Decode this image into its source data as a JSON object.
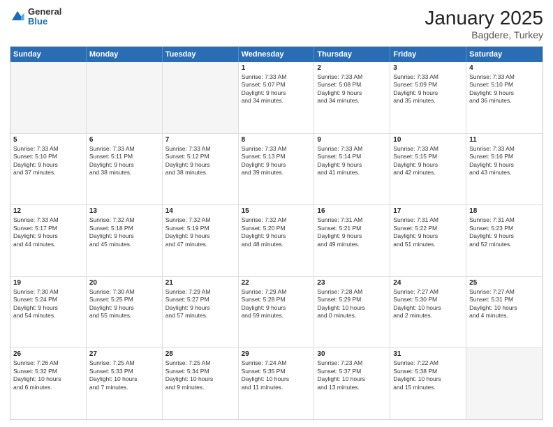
{
  "header": {
    "logo_general": "General",
    "logo_blue": "Blue",
    "title": "January 2025",
    "subtitle": "Bagdere, Turkey"
  },
  "calendar": {
    "days_of_week": [
      "Sunday",
      "Monday",
      "Tuesday",
      "Wednesday",
      "Thursday",
      "Friday",
      "Saturday"
    ],
    "weeks": [
      [
        {
          "day": "",
          "content": ""
        },
        {
          "day": "",
          "content": ""
        },
        {
          "day": "",
          "content": ""
        },
        {
          "day": "1",
          "content": "Sunrise: 7:33 AM\nSunset: 5:07 PM\nDaylight: 9 hours\nand 34 minutes."
        },
        {
          "day": "2",
          "content": "Sunrise: 7:33 AM\nSunset: 5:08 PM\nDaylight: 9 hours\nand 34 minutes."
        },
        {
          "day": "3",
          "content": "Sunrise: 7:33 AM\nSunset: 5:09 PM\nDaylight: 9 hours\nand 35 minutes."
        },
        {
          "day": "4",
          "content": "Sunrise: 7:33 AM\nSunset: 5:10 PM\nDaylight: 9 hours\nand 36 minutes."
        }
      ],
      [
        {
          "day": "5",
          "content": "Sunrise: 7:33 AM\nSunset: 5:10 PM\nDaylight: 9 hours\nand 37 minutes."
        },
        {
          "day": "6",
          "content": "Sunrise: 7:33 AM\nSunset: 5:11 PM\nDaylight: 9 hours\nand 38 minutes."
        },
        {
          "day": "7",
          "content": "Sunrise: 7:33 AM\nSunset: 5:12 PM\nDaylight: 9 hours\nand 38 minutes."
        },
        {
          "day": "8",
          "content": "Sunrise: 7:33 AM\nSunset: 5:13 PM\nDaylight: 9 hours\nand 39 minutes."
        },
        {
          "day": "9",
          "content": "Sunrise: 7:33 AM\nSunset: 5:14 PM\nDaylight: 9 hours\nand 41 minutes."
        },
        {
          "day": "10",
          "content": "Sunrise: 7:33 AM\nSunset: 5:15 PM\nDaylight: 9 hours\nand 42 minutes."
        },
        {
          "day": "11",
          "content": "Sunrise: 7:33 AM\nSunset: 5:16 PM\nDaylight: 9 hours\nand 43 minutes."
        }
      ],
      [
        {
          "day": "12",
          "content": "Sunrise: 7:33 AM\nSunset: 5:17 PM\nDaylight: 9 hours\nand 44 minutes."
        },
        {
          "day": "13",
          "content": "Sunrise: 7:32 AM\nSunset: 5:18 PM\nDaylight: 9 hours\nand 45 minutes."
        },
        {
          "day": "14",
          "content": "Sunrise: 7:32 AM\nSunset: 5:19 PM\nDaylight: 9 hours\nand 47 minutes."
        },
        {
          "day": "15",
          "content": "Sunrise: 7:32 AM\nSunset: 5:20 PM\nDaylight: 9 hours\nand 48 minutes."
        },
        {
          "day": "16",
          "content": "Sunrise: 7:31 AM\nSunset: 5:21 PM\nDaylight: 9 hours\nand 49 minutes."
        },
        {
          "day": "17",
          "content": "Sunrise: 7:31 AM\nSunset: 5:22 PM\nDaylight: 9 hours\nand 51 minutes."
        },
        {
          "day": "18",
          "content": "Sunrise: 7:31 AM\nSunset: 5:23 PM\nDaylight: 9 hours\nand 52 minutes."
        }
      ],
      [
        {
          "day": "19",
          "content": "Sunrise: 7:30 AM\nSunset: 5:24 PM\nDaylight: 9 hours\nand 54 minutes."
        },
        {
          "day": "20",
          "content": "Sunrise: 7:30 AM\nSunset: 5:25 PM\nDaylight: 9 hours\nand 55 minutes."
        },
        {
          "day": "21",
          "content": "Sunrise: 7:29 AM\nSunset: 5:27 PM\nDaylight: 9 hours\nand 57 minutes."
        },
        {
          "day": "22",
          "content": "Sunrise: 7:29 AM\nSunset: 5:28 PM\nDaylight: 9 hours\nand 59 minutes."
        },
        {
          "day": "23",
          "content": "Sunrise: 7:28 AM\nSunset: 5:29 PM\nDaylight: 10 hours\nand 0 minutes."
        },
        {
          "day": "24",
          "content": "Sunrise: 7:27 AM\nSunset: 5:30 PM\nDaylight: 10 hours\nand 2 minutes."
        },
        {
          "day": "25",
          "content": "Sunrise: 7:27 AM\nSunset: 5:31 PM\nDaylight: 10 hours\nand 4 minutes."
        }
      ],
      [
        {
          "day": "26",
          "content": "Sunrise: 7:26 AM\nSunset: 5:32 PM\nDaylight: 10 hours\nand 6 minutes."
        },
        {
          "day": "27",
          "content": "Sunrise: 7:25 AM\nSunset: 5:33 PM\nDaylight: 10 hours\nand 7 minutes."
        },
        {
          "day": "28",
          "content": "Sunrise: 7:25 AM\nSunset: 5:34 PM\nDaylight: 10 hours\nand 9 minutes."
        },
        {
          "day": "29",
          "content": "Sunrise: 7:24 AM\nSunset: 5:35 PM\nDaylight: 10 hours\nand 11 minutes."
        },
        {
          "day": "30",
          "content": "Sunrise: 7:23 AM\nSunset: 5:37 PM\nDaylight: 10 hours\nand 13 minutes."
        },
        {
          "day": "31",
          "content": "Sunrise: 7:22 AM\nSunset: 5:38 PM\nDaylight: 10 hours\nand 15 minutes."
        },
        {
          "day": "",
          "content": ""
        }
      ]
    ]
  }
}
